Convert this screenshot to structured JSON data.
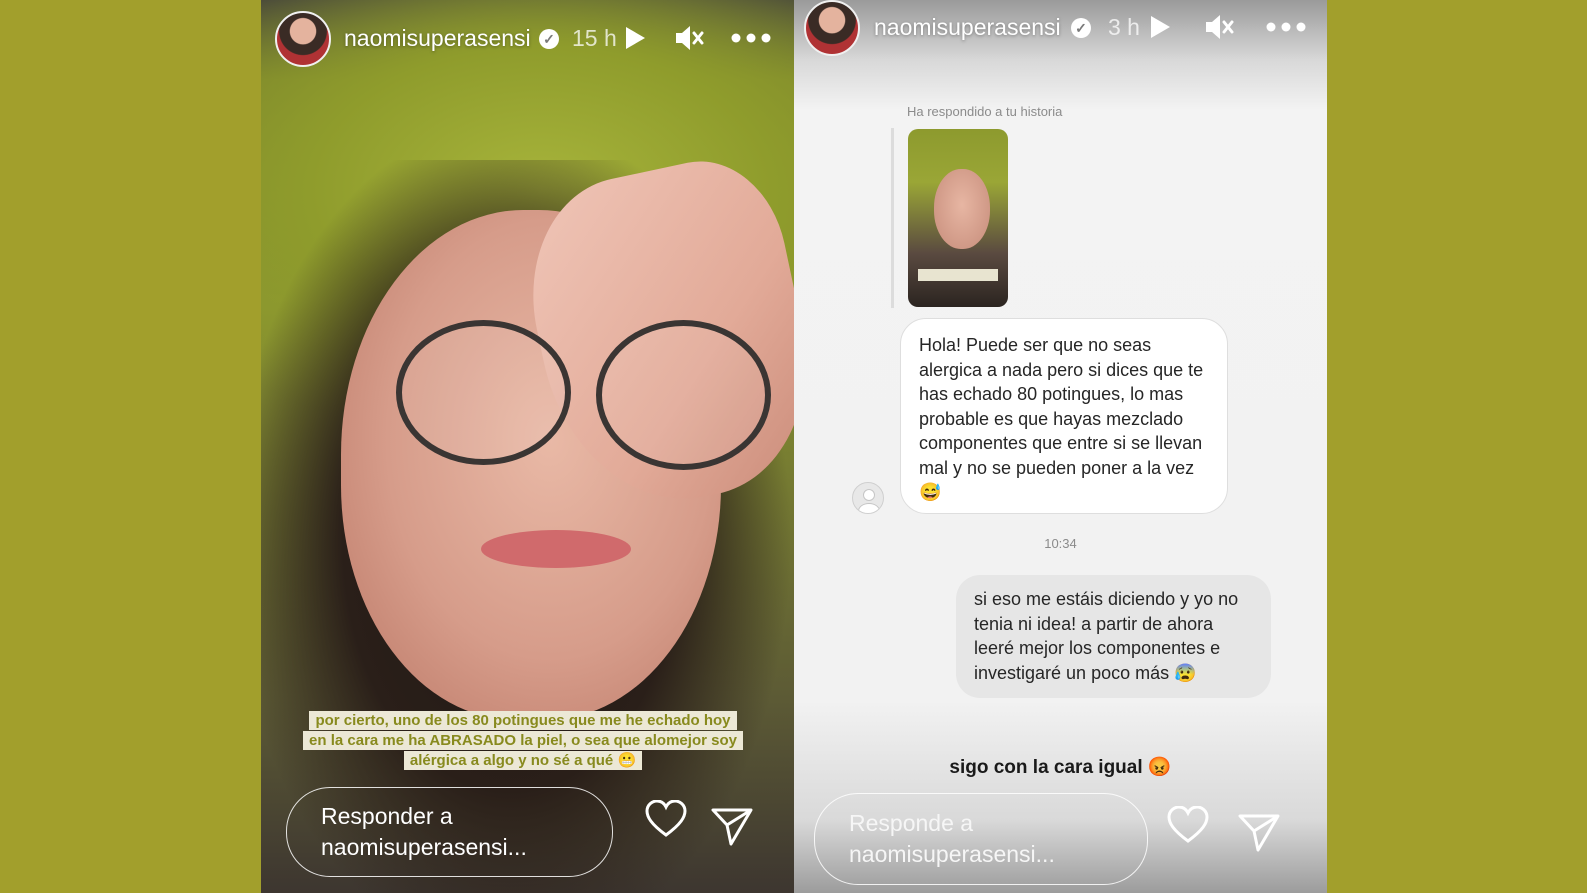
{
  "left_story": {
    "username": "naomisuperasensi",
    "verified_icon": "verified-badge-icon",
    "time": "15 h",
    "caption": "por cierto, uno de los 80 potingues que me he echado hoy en la cara me ha ABRASADO la piel, o sea que alomejor soy alérgica a algo y no sé a qué 😬",
    "reply_placeholder": "Responder a naomisuperasensi...",
    "icons": [
      "play-icon",
      "muted-speaker-icon",
      "more-options-icon",
      "heart-icon",
      "send-icon"
    ]
  },
  "right_story": {
    "username": "naomisuperasensi",
    "verified_icon": "verified-badge-icon",
    "time": "3 h",
    "replied_label": "Ha respondido a tu historia",
    "incoming_message": "Hola! Puede ser que no seas alergica a nada pero si dices que te has echado 80 potingues, lo mas probable es que hayas mezclado componentes que entre si se llevan mal y no se pueden poner a la vez 😅",
    "message_time": "10:34",
    "outgoing_message": "si eso me estáis diciendo y yo no tenia ni idea! a partir de ahora leeré mejor los componentes e investigaré un poco más 😰",
    "bottom_text": "sigo con la cara igual 😡",
    "reply_placeholder": "Responde a naomisuperasensi...",
    "icons": [
      "play-icon",
      "muted-speaker-icon",
      "more-options-icon",
      "heart-icon",
      "send-icon"
    ]
  },
  "colors": {
    "page_background": "#a29f2c",
    "caption_text": "#888a1e",
    "caption_background": "#ece8d6"
  }
}
